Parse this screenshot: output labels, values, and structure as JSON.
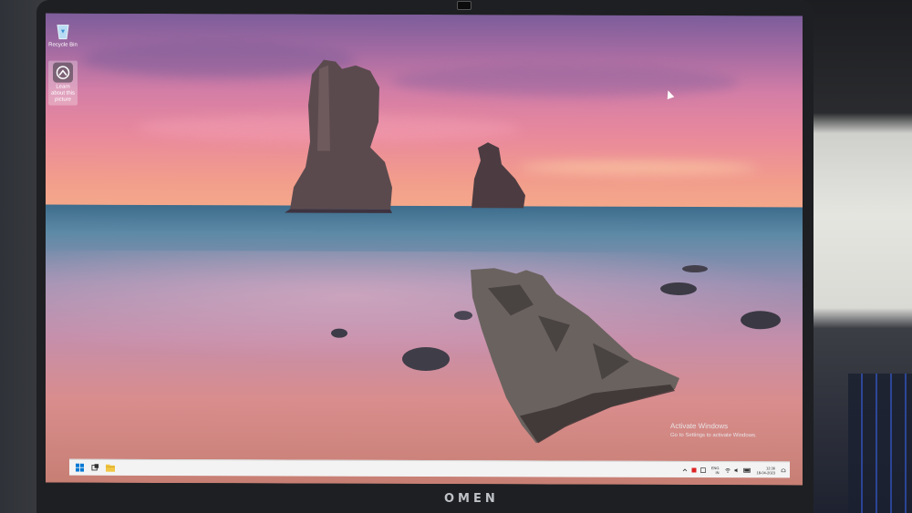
{
  "desktop": {
    "icons": [
      {
        "label": "Recycle Bin",
        "icon": "recycle-bin-icon"
      },
      {
        "label": "Learn about this picture",
        "icon": "learn-picture-icon"
      }
    ]
  },
  "watermark": {
    "title": "Activate Windows",
    "subtitle": "Go to Settings to activate Windows."
  },
  "taskbar": {
    "buttons": [
      {
        "name": "start-button",
        "icon": "windows-logo-icon",
        "color": "#0078d4"
      },
      {
        "name": "search-button",
        "icon": "taskview-icon",
        "color": "#333333"
      },
      {
        "name": "file-explorer-button",
        "icon": "folder-icon",
        "color": "#f2c744"
      }
    ],
    "tray": {
      "language": "ENG",
      "region": "IN",
      "time": "12:36",
      "date": "18-04-2023"
    }
  },
  "laptop": {
    "brand": "OMEN"
  },
  "colors": {
    "taskbar_bg": "#f3f3f3",
    "start_accent": "#0078d4"
  }
}
